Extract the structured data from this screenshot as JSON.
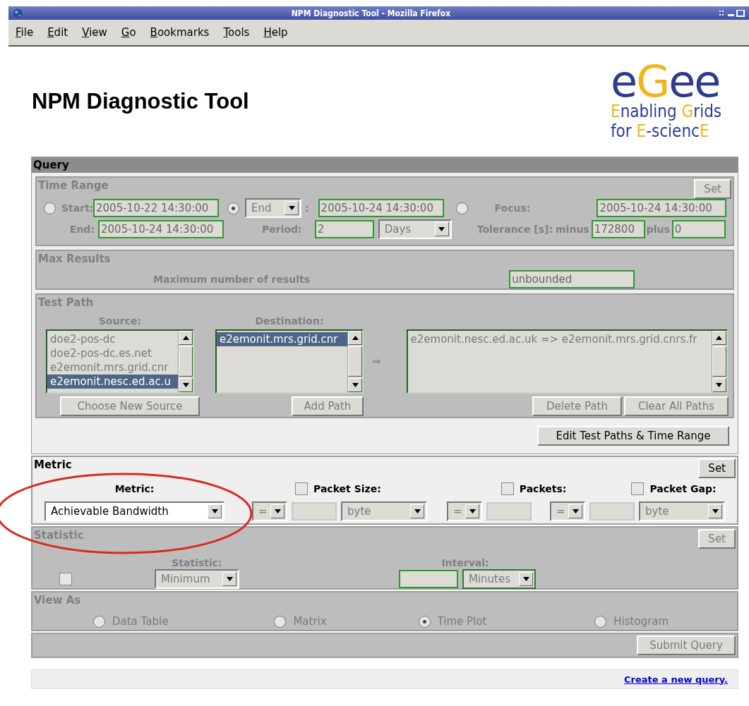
{
  "window": {
    "title": "NPM Diagnostic Tool - Mozilla Firefox"
  },
  "menu": [
    {
      "label": "File"
    },
    {
      "label": "Edit"
    },
    {
      "label": "View"
    },
    {
      "label": "Go"
    },
    {
      "label": "Bookmarks"
    },
    {
      "label": "Tools"
    },
    {
      "label": "Help"
    }
  ],
  "heading": "NPM Diagnostic Tool",
  "logo": {
    "wordmark": [
      {
        "text": "e",
        "color": "#2e3b8f"
      },
      {
        "text": "G",
        "color": "#f2b418"
      },
      {
        "text": "e",
        "color": "#2e3b8f"
      },
      {
        "text": "e",
        "color": "#2e3b8f"
      }
    ],
    "tagline": [
      [
        {
          "text": "E",
          "color": "#f2b418"
        },
        {
          "text": "nabling ",
          "color": "#2e3b8f"
        },
        {
          "text": "G",
          "color": "#f2b418"
        },
        {
          "text": "rids",
          "color": "#2e3b8f"
        }
      ],
      [
        {
          "text": "for ",
          "color": "#2e3b8f"
        },
        {
          "text": "E",
          "color": "#f2b418"
        },
        {
          "text": "-scienc",
          "color": "#2e3b8f"
        },
        {
          "text": "E",
          "color": "#f2b418"
        }
      ]
    ]
  },
  "query": {
    "title": "Query",
    "time_range": {
      "title": "Time Range",
      "disabled": true,
      "set_button": "Set",
      "start": {
        "label": "Start:",
        "value": "2005-10-22 14:30:00",
        "selected": false
      },
      "end_mode": {
        "select": "End",
        "colon": ":",
        "value": "2005-10-24 14:30:00",
        "selected": true
      },
      "focus": {
        "label": "Focus:",
        "value": "2005-10-24 14:30:00",
        "selected": false
      },
      "end": {
        "label": "End:",
        "value": "2005-10-24 14:30:00"
      },
      "period": {
        "label": "Period:",
        "value": "2",
        "unit": "Days"
      },
      "tolerance": {
        "label": "Tolerance [s]:",
        "minus_label": "minus",
        "minus": "172800",
        "plus_label": "plus",
        "plus": "0"
      }
    },
    "max_results": {
      "title": "Max Results",
      "disabled": true,
      "label": "Maximum number of results",
      "value": "unbounded"
    },
    "test_path": {
      "title": "Test Path",
      "disabled": true,
      "source": {
        "label": "Source:",
        "items": [
          {
            "text": "doe2-pos-dc",
            "selected": false
          },
          {
            "text": "doe2-pos-dc.es.net",
            "selected": false
          },
          {
            "text": "e2emonit.mrs.grid.cnr",
            "selected": false
          },
          {
            "text": "e2emonit.nesc.ed.ac.u",
            "selected": true
          }
        ]
      },
      "destination": {
        "label": "Destination:",
        "items": [
          {
            "text": "e2emonit.mrs.grid.cnr",
            "selected": true
          }
        ]
      },
      "arrow": "⇒",
      "paths": [
        {
          "text": "e2emonit.nesc.ed.ac.uk => e2emonit.mrs.grid.cnrs.fr",
          "selected": false
        }
      ],
      "buttons": {
        "choose_source": "Choose New Source",
        "add_path": "Add Path",
        "delete_path": "Delete Path",
        "clear_paths": "Clear All Paths"
      }
    },
    "edit_button": "Edit Test Paths & Time Range"
  },
  "metric": {
    "title": "Metric",
    "disabled": false,
    "set_button": "Set",
    "label": "Metric:",
    "value": "Achievable Bandwidth",
    "filters": [
      {
        "label": "Packet Size:",
        "checked": false,
        "operator": "=",
        "unit": "byte"
      },
      {
        "label": "Packets:",
        "checked": false,
        "operator": "="
      },
      {
        "label": "Packet Gap:",
        "checked": false,
        "operator": "=",
        "unit": "byte"
      }
    ]
  },
  "statistic": {
    "title": "Statistic",
    "disabled": true,
    "set_button": "Set",
    "checked": false,
    "label": "Statistic:",
    "value": "Minimum",
    "interval_label": "Interval:",
    "interval_unit": "Minutes"
  },
  "view_as": {
    "title": "View As",
    "disabled": true,
    "options": [
      {
        "label": "Data Table",
        "selected": false
      },
      {
        "label": "Matrix",
        "selected": false
      },
      {
        "label": "Time Plot",
        "selected": true
      },
      {
        "label": "Histogram",
        "selected": false
      }
    ]
  },
  "submit_button": "Submit Query",
  "footer": {
    "link": "Create a new query."
  },
  "annotation": {
    "kind": "ellipse",
    "color": "#d52b1e"
  }
}
